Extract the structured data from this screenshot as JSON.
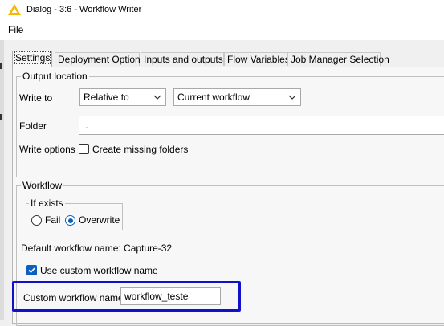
{
  "window": {
    "title": "Dialog - 3:6 - Workflow Writer"
  },
  "menu": {
    "file": "File"
  },
  "tabs": [
    {
      "label": "Settings"
    },
    {
      "label": "Deployment Options"
    },
    {
      "label": "Inputs and outputs"
    },
    {
      "label": "Flow Variables"
    },
    {
      "label": "Job Manager Selection"
    }
  ],
  "output_location": {
    "legend": "Output location",
    "write_to_label": "Write to",
    "write_to_value": "Relative to",
    "relative_value": "Current workflow",
    "folder_label": "Folder",
    "folder_value": "..",
    "write_options_label": "Write options",
    "create_missing_label": "Create missing folders"
  },
  "workflow": {
    "legend": "Workflow",
    "if_exists_legend": "If exists",
    "fail_label": "Fail",
    "overwrite_label": "Overwrite",
    "selected_option": "Overwrite",
    "default_name_text": "Default workflow name: Capture-32",
    "use_custom_label": "Use custom workflow name",
    "custom_name_label": "Custom workflow name",
    "custom_name_value": "workflow_teste"
  },
  "colors": {
    "accent": "#0b5fbf",
    "highlight": "#1111cc",
    "logo": "#f5b800"
  }
}
